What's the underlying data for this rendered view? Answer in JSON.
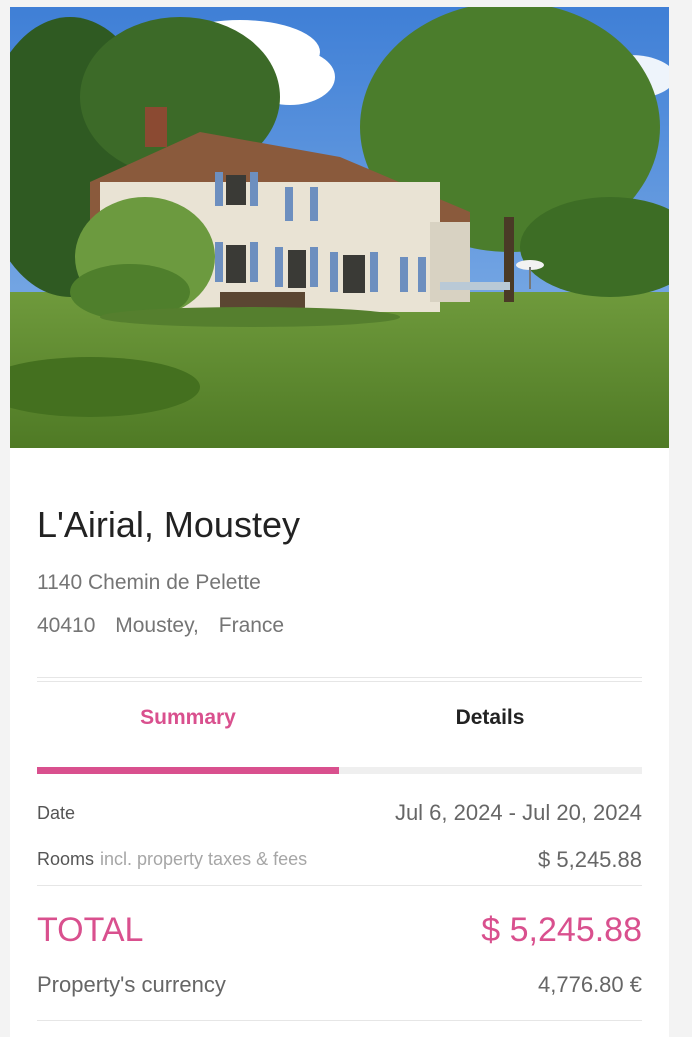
{
  "property": {
    "name": "L'Airial, Moustey",
    "address_line1": "1140 Chemin de Pelette",
    "postal_code": "40410",
    "city": "Moustey,",
    "country": "France",
    "photo_alt": "Photo of the property"
  },
  "tabs": [
    {
      "label": "Summary",
      "active": true
    },
    {
      "label": "Details",
      "active": false
    }
  ],
  "summary": {
    "date_label": "Date",
    "date_value": "Jul 6, 2024 - Jul 20, 2024",
    "rooms_label": "Rooms",
    "rooms_note": "incl. property taxes & fees",
    "rooms_value": "$ 5,245.88",
    "total_label": "TOTAL",
    "total_value": "$ 5,245.88",
    "currency_label": "Property's currency",
    "currency_value": "4,776.80 €"
  },
  "colors": {
    "accent": "#d9508e",
    "text_dark": "#222222",
    "text_muted": "#757575"
  }
}
